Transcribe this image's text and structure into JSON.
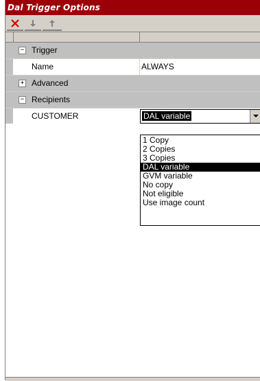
{
  "window": {
    "title": "Dal Trigger Options"
  },
  "toolbar": {
    "delete_icon": "close-x-icon",
    "down_icon": "arrow-down-icon",
    "up_icon": "arrow-up-icon"
  },
  "grid": {
    "rows": [
      {
        "type": "group",
        "expander": "−",
        "label": "Trigger"
      },
      {
        "type": "item",
        "label": "Name",
        "value": "ALWAYS"
      },
      {
        "type": "group",
        "expander": "+",
        "label": "Advanced"
      },
      {
        "type": "group",
        "expander": "−",
        "label": "Recipients"
      },
      {
        "type": "item",
        "label": "CUSTOMER",
        "value": "DAL variable"
      }
    ]
  },
  "dropdown": {
    "selected": "DAL variable",
    "options": [
      "1 Copy",
      "2 Copies",
      "3 Copies",
      "DAL variable",
      "GVM variable",
      "No copy",
      "Not eligible",
      "Use image count"
    ]
  },
  "colors": {
    "title_bg": "#9b0009",
    "chrome": "#d4d0c8",
    "group_bg": "#c0c0c0",
    "delete_red": "#cc0000"
  }
}
